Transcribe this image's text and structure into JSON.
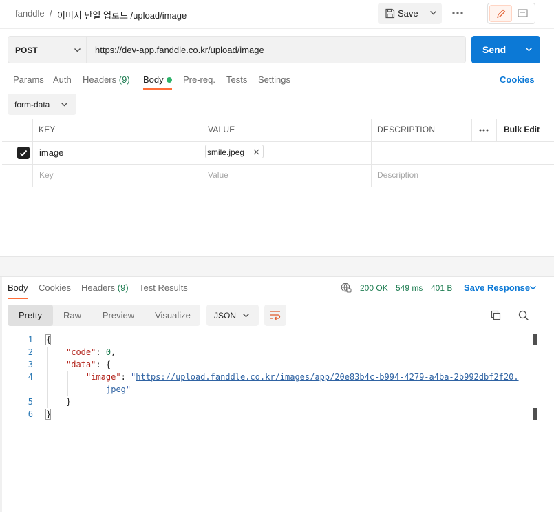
{
  "breadcrumb": {
    "collection": "fanddle",
    "separator": "/",
    "request_name": "이미지 단일 업로드 /upload/image"
  },
  "toolbar": {
    "save_label": "Save",
    "more_icon": "more-horizontal-icon",
    "edit_icon": "pencil-icon",
    "comment_icon": "comment-icon"
  },
  "request": {
    "method": "POST",
    "url": "https://dev-app.fanddle.co.kr/upload/image",
    "send_label": "Send"
  },
  "request_tabs": [
    {
      "label": "Params",
      "count": ""
    },
    {
      "label": "Auth",
      "count": ""
    },
    {
      "label": "Headers",
      "count": "(9)"
    },
    {
      "label": "Body",
      "count": ""
    },
    {
      "label": "Pre-req.",
      "count": ""
    },
    {
      "label": "Tests",
      "count": ""
    },
    {
      "label": "Settings",
      "count": ""
    }
  ],
  "cookies_label": "Cookies",
  "body_type": "form-data",
  "table": {
    "headers": {
      "key": "KEY",
      "value": "VALUE",
      "description": "DESCRIPTION",
      "bulk_edit": "Bulk Edit"
    },
    "rows": [
      {
        "checked": true,
        "key": "image",
        "value_file": "smile.jpeg",
        "description": ""
      }
    ],
    "placeholders": {
      "key": "Key",
      "value": "Value",
      "description": "Description"
    }
  },
  "response": {
    "tabs": [
      {
        "label": "Body",
        "count": ""
      },
      {
        "label": "Cookies",
        "count": ""
      },
      {
        "label": "Headers",
        "count": "(9)"
      },
      {
        "label": "Test Results",
        "count": ""
      }
    ],
    "status": "200 OK",
    "time": "549 ms",
    "size": "401 B",
    "save_response_label": "Save Response",
    "view_tabs": [
      "Pretty",
      "Raw",
      "Preview",
      "Visualize"
    ],
    "format": "JSON",
    "code": {
      "line_numbers": [
        "1",
        "2",
        "3",
        "4",
        "5",
        "6"
      ],
      "code_key": "\"code\"",
      "code_value": "0",
      "data_key": "\"data\"",
      "image_key": "\"image\"",
      "image_url_line1": "https://upload.fanddle.co.kr/images/app/20e83b4c-b994-4279-a4ba-2b992dbf2f20.",
      "image_url_line2": "jpeg"
    }
  },
  "colors": {
    "accent_orange": "#ff6c37",
    "send_blue": "#0c79d6",
    "link_blue": "#0c79d6",
    "status_green": "#1f7d52",
    "body_dot_green": "#2db36a"
  }
}
